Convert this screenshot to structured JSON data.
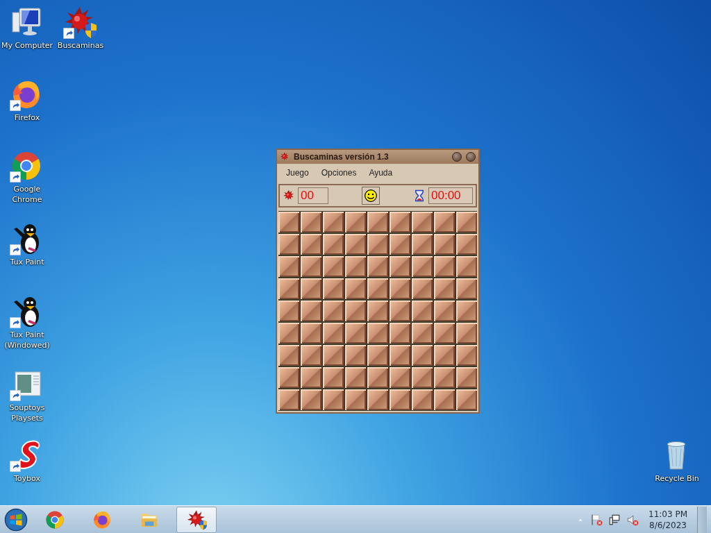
{
  "desktop_icons": [
    {
      "kind": "computer",
      "label": "My Computer",
      "shortcut": false
    },
    {
      "kind": "mine",
      "label": "Buscaminas",
      "shortcut": true
    },
    {
      "kind": "firefox",
      "label": "Firefox",
      "shortcut": true
    },
    {
      "kind": "chrome",
      "label": "Google Chrome",
      "shortcut": true
    },
    {
      "kind": "tux",
      "label": "Tux Paint",
      "shortcut": true
    },
    {
      "kind": "tux",
      "label": "Tux Paint (Windowed)",
      "shortcut": true
    },
    {
      "kind": "souptoys",
      "label": "Souptoys Playsets",
      "shortcut": true
    },
    {
      "kind": "toybox",
      "label": "Toybox",
      "shortcut": true
    },
    {
      "kind": "recycle",
      "label": "Recycle Bin",
      "shortcut": false
    }
  ],
  "window": {
    "title": "Buscaminas versión 1.3",
    "menu": [
      "Juego",
      "Opciones",
      "Ayuda"
    ],
    "mine_counter": "00",
    "timer": "00:00",
    "board": [
      [
        {
          "revealed": false
        },
        {
          "revealed": false
        },
        {
          "revealed": false
        },
        {
          "revealed": false
        },
        {
          "revealed": false
        },
        {
          "revealed": false
        },
        {
          "revealed": false
        },
        {
          "revealed": false
        },
        {
          "revealed": false
        }
      ],
      [
        {
          "revealed": false
        },
        {
          "revealed": false
        },
        {
          "revealed": false
        },
        {
          "revealed": false
        },
        {
          "revealed": false
        },
        {
          "revealed": false
        },
        {
          "revealed": false
        },
        {
          "revealed": false
        },
        {
          "revealed": false
        }
      ],
      [
        {
          "revealed": false
        },
        {
          "revealed": false
        },
        {
          "revealed": false
        },
        {
          "revealed": false
        },
        {
          "revealed": false
        },
        {
          "revealed": false
        },
        {
          "revealed": false
        },
        {
          "revealed": false
        },
        {
          "revealed": false
        }
      ],
      [
        {
          "revealed": false
        },
        {
          "revealed": false
        },
        {
          "revealed": false
        },
        {
          "revealed": false
        },
        {
          "revealed": false
        },
        {
          "revealed": false
        },
        {
          "revealed": false
        },
        {
          "revealed": false
        },
        {
          "revealed": false
        }
      ],
      [
        {
          "revealed": false
        },
        {
          "revealed": false
        },
        {
          "revealed": false
        },
        {
          "revealed": false
        },
        {
          "revealed": false
        },
        {
          "revealed": false
        },
        {
          "revealed": false
        },
        {
          "revealed": false
        },
        {
          "revealed": false
        }
      ],
      [
        {
          "revealed": false
        },
        {
          "revealed": false
        },
        {
          "revealed": false
        },
        {
          "revealed": false
        },
        {
          "revealed": false
        },
        {
          "revealed": false
        },
        {
          "revealed": false
        },
        {
          "revealed": false
        },
        {
          "revealed": false
        }
      ],
      [
        {
          "revealed": false
        },
        {
          "revealed": false
        },
        {
          "revealed": false
        },
        {
          "revealed": false
        },
        {
          "revealed": false
        },
        {
          "revealed": false
        },
        {
          "revealed": false
        },
        {
          "revealed": false
        },
        {
          "revealed": false
        }
      ],
      [
        {
          "revealed": false
        },
        {
          "revealed": false
        },
        {
          "revealed": false
        },
        {
          "revealed": false
        },
        {
          "revealed": false
        },
        {
          "revealed": false
        },
        {
          "revealed": false
        },
        {
          "revealed": false
        },
        {
          "revealed": false
        }
      ],
      [
        {
          "revealed": false
        },
        {
          "revealed": false
        },
        {
          "revealed": false
        },
        {
          "revealed": false
        },
        {
          "revealed": false
        },
        {
          "revealed": false
        },
        {
          "revealed": false
        },
        {
          "revealed": false
        },
        {
          "revealed": false
        }
      ]
    ]
  },
  "taskbar": {
    "items": [
      {
        "kind": "chrome",
        "active": false
      },
      {
        "kind": "firefox",
        "active": false
      },
      {
        "kind": "folder",
        "active": false
      },
      {
        "kind": "mine",
        "active": true
      }
    ],
    "time": "11:03 PM",
    "date": "8/6/2023"
  }
}
